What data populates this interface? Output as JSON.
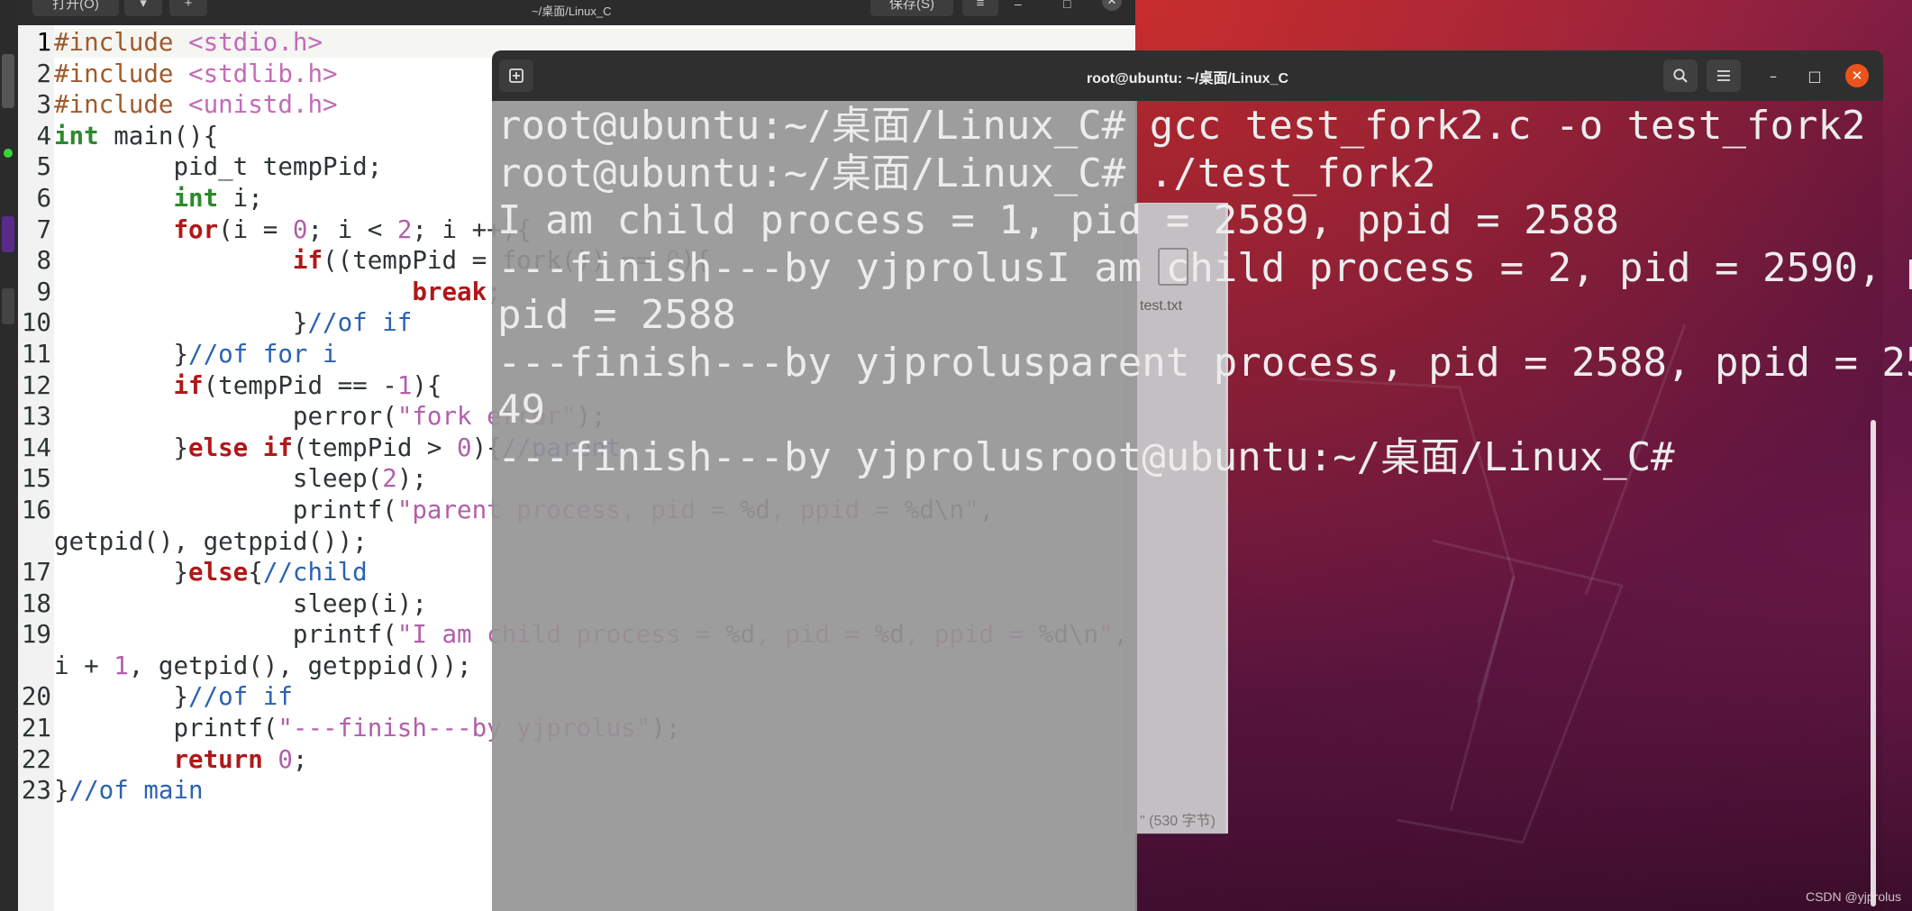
{
  "editor": {
    "open_label": "打开(O)",
    "dropdown_icon": "chevron-down-icon",
    "new_tab_icon": "new-tab-icon",
    "path": "~/桌面/Linux_C",
    "save_label": "保存(S)",
    "menu_icon": "hamburger-menu-icon",
    "lines": [
      {
        "num": "1",
        "tokens": [
          [
            "pp",
            "#include "
          ],
          [
            "inc",
            "<stdio.h>"
          ]
        ]
      },
      {
        "num": "2",
        "tokens": [
          [
            "pp",
            "#include "
          ],
          [
            "inc",
            "<stdlib.h>"
          ]
        ]
      },
      {
        "num": "3",
        "tokens": [
          [
            "pp",
            "#include "
          ],
          [
            "inc",
            "<unistd.h>"
          ]
        ]
      },
      {
        "num": "4",
        "tokens": [
          [
            "type",
            "int"
          ],
          [
            "plain",
            " main(){"
          ]
        ]
      },
      {
        "num": "5",
        "tokens": [
          [
            "plain",
            "        pid_t tempPid;"
          ]
        ]
      },
      {
        "num": "6",
        "tokens": [
          [
            "plain",
            "        "
          ],
          [
            "type",
            "int"
          ],
          [
            "plain",
            " i;"
          ]
        ]
      },
      {
        "num": "7",
        "tokens": [
          [
            "plain",
            "        "
          ],
          [
            "kw",
            "for"
          ],
          [
            "plain",
            "(i = "
          ],
          [
            "num",
            "0"
          ],
          [
            "plain",
            "; i < "
          ],
          [
            "num",
            "2"
          ],
          [
            "plain",
            "; i ++){"
          ]
        ]
      },
      {
        "num": "8",
        "tokens": [
          [
            "plain",
            "                "
          ],
          [
            "kw",
            "if"
          ],
          [
            "plain",
            "((tempPid = fork()) == "
          ],
          [
            "num",
            "0"
          ],
          [
            "plain",
            "){"
          ]
        ]
      },
      {
        "num": "9",
        "tokens": [
          [
            "plain",
            "                        "
          ],
          [
            "kw",
            "break"
          ],
          [
            "plain",
            ";"
          ]
        ]
      },
      {
        "num": "10",
        "tokens": [
          [
            "plain",
            "                }"
          ],
          [
            "cmt",
            "//of if"
          ]
        ]
      },
      {
        "num": "11",
        "tokens": [
          [
            "plain",
            "        }"
          ],
          [
            "cmt",
            "//of for i"
          ]
        ]
      },
      {
        "num": "12",
        "tokens": [
          [
            "plain",
            "        "
          ],
          [
            "kw",
            "if"
          ],
          [
            "plain",
            "(tempPid == -"
          ],
          [
            "num",
            "1"
          ],
          [
            "plain",
            "){"
          ]
        ]
      },
      {
        "num": "13",
        "tokens": [
          [
            "plain",
            "                perror("
          ],
          [
            "str",
            "\"fork error\""
          ],
          [
            "plain",
            ");"
          ]
        ]
      },
      {
        "num": "14",
        "tokens": [
          [
            "plain",
            "        }"
          ],
          [
            "kw",
            "else if"
          ],
          [
            "plain",
            "(tempPid > "
          ],
          [
            "num",
            "0"
          ],
          [
            "plain",
            "){"
          ],
          [
            "cmt",
            "//parent"
          ]
        ]
      },
      {
        "num": "15",
        "tokens": [
          [
            "plain",
            "                sleep("
          ],
          [
            "num",
            "2"
          ],
          [
            "plain",
            ");"
          ]
        ]
      },
      {
        "num": "16",
        "tokens": [
          [
            "plain",
            "                printf("
          ],
          [
            "str",
            "\"parent process, pid = "
          ],
          [
            "fmt",
            "%d"
          ],
          [
            "str",
            ", ppid = "
          ],
          [
            "fmt",
            "%d\\n"
          ],
          [
            "str",
            "\""
          ],
          [
            "plain",
            ","
          ]
        ]
      },
      {
        "num": "",
        "tokens": [
          [
            "plain",
            "getpid(), getppid());"
          ]
        ]
      },
      {
        "num": "17",
        "tokens": [
          [
            "plain",
            "        }"
          ],
          [
            "kw",
            "else"
          ],
          [
            "plain",
            "{"
          ],
          [
            "cmt",
            "//child"
          ]
        ]
      },
      {
        "num": "18",
        "tokens": [
          [
            "plain",
            "                sleep(i);"
          ]
        ]
      },
      {
        "num": "19",
        "tokens": [
          [
            "plain",
            "                printf("
          ],
          [
            "str",
            "\"I am child process = "
          ],
          [
            "fmt",
            "%d"
          ],
          [
            "str",
            ", pid = "
          ],
          [
            "fmt",
            "%d"
          ],
          [
            "str",
            ", ppid = "
          ],
          [
            "fmt",
            "%d\\n"
          ],
          [
            "str",
            "\""
          ],
          [
            "plain",
            ","
          ]
        ]
      },
      {
        "num": "",
        "tokens": [
          [
            "plain",
            "i + "
          ],
          [
            "num",
            "1"
          ],
          [
            "plain",
            ", getpid(), getppid());"
          ]
        ]
      },
      {
        "num": "20",
        "tokens": [
          [
            "plain",
            "        }"
          ],
          [
            "cmt",
            "//of if"
          ]
        ]
      },
      {
        "num": "21",
        "tokens": [
          [
            "plain",
            "        printf("
          ],
          [
            "str",
            "\"---finish---by yjprolus\""
          ],
          [
            "plain",
            ");"
          ]
        ]
      },
      {
        "num": "22",
        "tokens": [
          [
            "plain",
            "        "
          ],
          [
            "kw",
            "return"
          ],
          [
            "plain",
            " "
          ],
          [
            "num",
            "0"
          ],
          [
            "plain",
            ";"
          ]
        ]
      },
      {
        "num": "23",
        "tokens": [
          [
            "plain",
            "}"
          ],
          [
            "cmt",
            "//of main"
          ]
        ]
      }
    ]
  },
  "files": {
    "file_name": "test.txt",
    "status": "\" (530 字节)"
  },
  "terminal": {
    "title": "root@ubuntu: ~/桌面/Linux_C",
    "new_tab_icon": "new-tab-icon",
    "search_icon": "search-icon",
    "menu_icon": "hamburger-menu-icon",
    "output_lines": [
      "root@ubuntu:~/桌面/Linux_C# gcc test_fork2.c -o test_fork2",
      "root@ubuntu:~/桌面/Linux_C# ./test_fork2",
      "I am child process = 1, pid = 2589, ppid = 2588",
      "---finish---by yjprolusI am child process = 2, pid = 2590, p",
      "pid = 2588",
      "---finish---by yjprolusparent process, pid = 2588, ppid = 25",
      "49",
      "---finish---by yjprolusroot@ubuntu:~/桌面/Linux_C#"
    ]
  },
  "watermark": "CSDN @yjprolus",
  "colors": {
    "terminal_close": "#e9541c",
    "editor_comment": "#2a62b0",
    "editor_keyword": "#b01818",
    "editor_type": "#2c8a2c"
  }
}
